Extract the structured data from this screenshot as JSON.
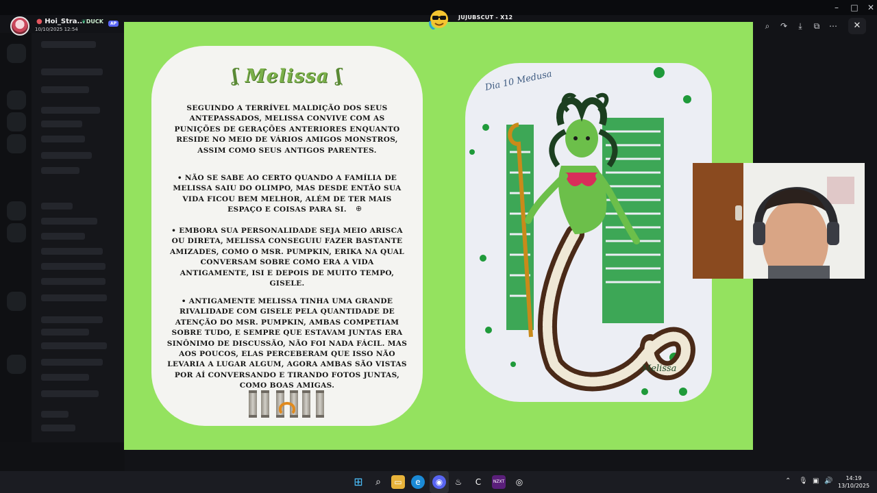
{
  "viewer": {
    "username": "Hoi_Stra...",
    "date": "10/10/2025 12:54",
    "tag": "DUCK",
    "badge": "AP"
  },
  "streamer": {
    "name": "JUJUBSCUT - X12"
  },
  "slide": {
    "title": "Melissa",
    "paragraphs": [
      "Seguindo a terrível maldição dos seus antepassados, Melissa convive com as punições de gerações anteriores enquanto reside no meio de vários amigos monstros, assim como seus antigos parentes.",
      "• Não se sabe ao certo quando a família de Melissa saiu do Olimpo, mas desde então sua vida ficou bem melhor, além de ter mais espaço e coisas para si.",
      "• Embora sua personalidade seja meio arisca ou direta, Melissa conseguiu fazer bastante amizades, como o Msr. Pumpkin, Erika na qual conversam sobre como era a vida antigamente, Isi e depois de muito tempo, Gisele.",
      "• Antigamente Melissa tinha uma grande rivalidade com Gisele pela quantidade de atenção do Msr. Pumpkin, ambas competiam sobre tudo, e sempre que estavam juntas era sinônimo de discussão, não foi nada fácil. Mas aos poucos, elas perceberam que isso não levaria a lugar algum, agora ambas são vistas por aí conversando e tirando fotos juntas, como boas amigas."
    ],
    "drawing_caption_top": "Dia 10 Medusa",
    "drawing_signature": "Melissa"
  },
  "clock": {
    "time": "14:19",
    "date": "13/10/2025"
  },
  "colors": {
    "slide_bg": "#94e25f",
    "accent_green": "#1f9a3a"
  }
}
